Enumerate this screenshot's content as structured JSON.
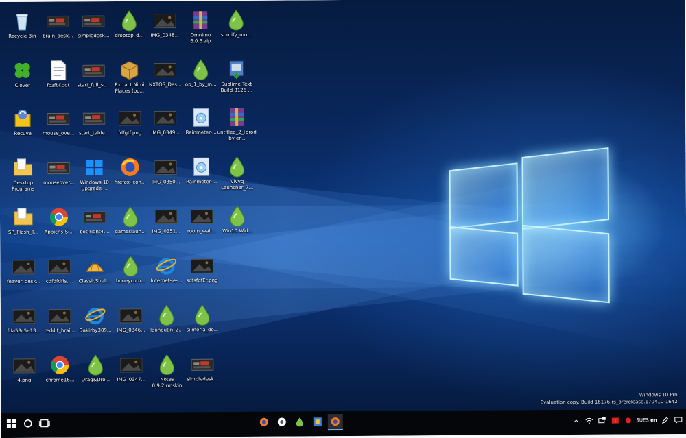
{
  "desktop": {
    "icons": [
      {
        "label": "Recycle Bin",
        "icon": "recycle-bin-icon"
      },
      {
        "label": "brain_desk...",
        "icon": "screenshot-thumbnail-icon"
      },
      {
        "label": "simpledesk...",
        "icon": "screenshot-thumbnail-icon"
      },
      {
        "label": "droptop_d...",
        "icon": "rainmeter-drop-icon"
      },
      {
        "label": "IMG_0348...",
        "icon": "image-thumbnail-icon"
      },
      {
        "label": "Omnimo 6.0.5.zip",
        "icon": "winrar-archive-icon"
      },
      {
        "label": "spotify_mo...",
        "icon": "rainmeter-drop-icon"
      },
      {
        "label": "Clover",
        "icon": "clover-icon"
      },
      {
        "label": "fbzfbf.odt",
        "icon": "document-icon"
      },
      {
        "label": "start_full_sc...",
        "icon": "screenshot-thumbnail-icon"
      },
      {
        "label": "Extract Nimi Places (po...",
        "icon": "package-icon"
      },
      {
        "label": "NXTOS_Des...",
        "icon": "image-thumbnail-icon"
      },
      {
        "label": "op_1_by_m...",
        "icon": "rainmeter-drop-icon"
      },
      {
        "label": "Sublime Text Build 3126 ...",
        "icon": "installer-icon"
      },
      {
        "label": "Recuva",
        "icon": "recuva-icon"
      },
      {
        "label": "mouse_ove...",
        "icon": "screenshot-thumbnail-icon"
      },
      {
        "label": "start_table...",
        "icon": "screenshot-thumbnail-icon"
      },
      {
        "label": "fdfgtf.png",
        "icon": "image-thumbnail-icon"
      },
      {
        "label": "IMG_0349...",
        "icon": "image-thumbnail-icon"
      },
      {
        "label": "Rainmeter-...",
        "icon": "rainmeter-installer-icon"
      },
      {
        "label": "untitled_2_[prod by er...",
        "icon": "winrar-archive-icon"
      },
      {
        "label": "Desktop Programs",
        "icon": "folder-icon"
      },
      {
        "label": "mouseover...",
        "icon": "screenshot-thumbnail-icon"
      },
      {
        "label": "Windows 10 Upgrade ...",
        "icon": "windows-upgrade-icon"
      },
      {
        "label": "firefox-icon...",
        "icon": "firefox-icon"
      },
      {
        "label": "IMG_0350...",
        "icon": "image-thumbnail-icon"
      },
      {
        "label": "Rainmeter-...",
        "icon": "rainmeter-installer-icon"
      },
      {
        "label": "Vivvq Launcher_7...",
        "icon": "rainmeter-drop-icon"
      },
      {
        "label": "SP_Flash_T...",
        "icon": "folder-icon"
      },
      {
        "label": "Appicns-Si...",
        "icon": "chrome-icon"
      },
      {
        "label": "bot-right4....",
        "icon": "screenshot-thumbnail-icon"
      },
      {
        "label": "gameslaun...",
        "icon": "rainmeter-drop-icon"
      },
      {
        "label": "IMG_0351...",
        "icon": "image-thumbnail-icon"
      },
      {
        "label": "room_wall...",
        "icon": "image-thumbnail-icon"
      },
      {
        "label": "Win10.Wid...",
        "icon": "rainmeter-drop-icon"
      },
      {
        "label": "feaver_desk...",
        "icon": "image-thumbnail-icon"
      },
      {
        "label": "cdfdfdffs....",
        "icon": "image-thumbnail-icon"
      },
      {
        "label": "ClassicShell...",
        "icon": "classic-shell-icon"
      },
      {
        "label": "honeycom...",
        "icon": "rainmeter-drop-icon"
      },
      {
        "label": "Internet-ie-...",
        "icon": "internet-explorer-icon"
      },
      {
        "label": "sdfsfdfEr.png",
        "icon": "image-thumbnail-icon"
      },
      {
        "label": "fda53c5e13...",
        "icon": "image-thumbnail-icon"
      },
      {
        "label": "reddit_brai...",
        "icon": "image-thumbnail-icon"
      },
      {
        "label": "Dakirby309...",
        "icon": "internet-explorer-icon"
      },
      {
        "label": "IMG_0346...",
        "icon": "image-thumbnail-icon"
      },
      {
        "label": "lauhdutin_2...",
        "icon": "rainmeter-drop-icon"
      },
      {
        "label": "silmeria_do...",
        "icon": "rainmeter-drop-icon"
      },
      {
        "label": "4.png",
        "icon": "image-thumbnail-icon"
      },
      {
        "label": "chrome16...",
        "icon": "chrome-icon"
      },
      {
        "label": "Drag&Dro...",
        "icon": "rainmeter-drop-icon"
      },
      {
        "label": "IMG_0347...",
        "icon": "image-thumbnail-icon"
      },
      {
        "label": "Notes 0.9.2.rmskin",
        "icon": "rainmeter-drop-icon"
      },
      {
        "label": "simpledesk...",
        "icon": "screenshot-thumbnail-icon"
      }
    ]
  },
  "watermark": {
    "edition": "Windows 10 Pro",
    "build": "Evaluation copy. Build 16176.rs_prerelease.170410-1642"
  },
  "taskbar": {
    "pinned": [
      "firefox-icon",
      "chrome-icon",
      "rainmeter-drop-icon",
      "app-icon",
      "firefox-active-icon"
    ],
    "tray_lang": "SUES 𝗲𝗻"
  },
  "colors": {
    "wallpaper_blue": "#0b3b84",
    "taskbar": "#05060a",
    "accent": "#0078d7"
  }
}
